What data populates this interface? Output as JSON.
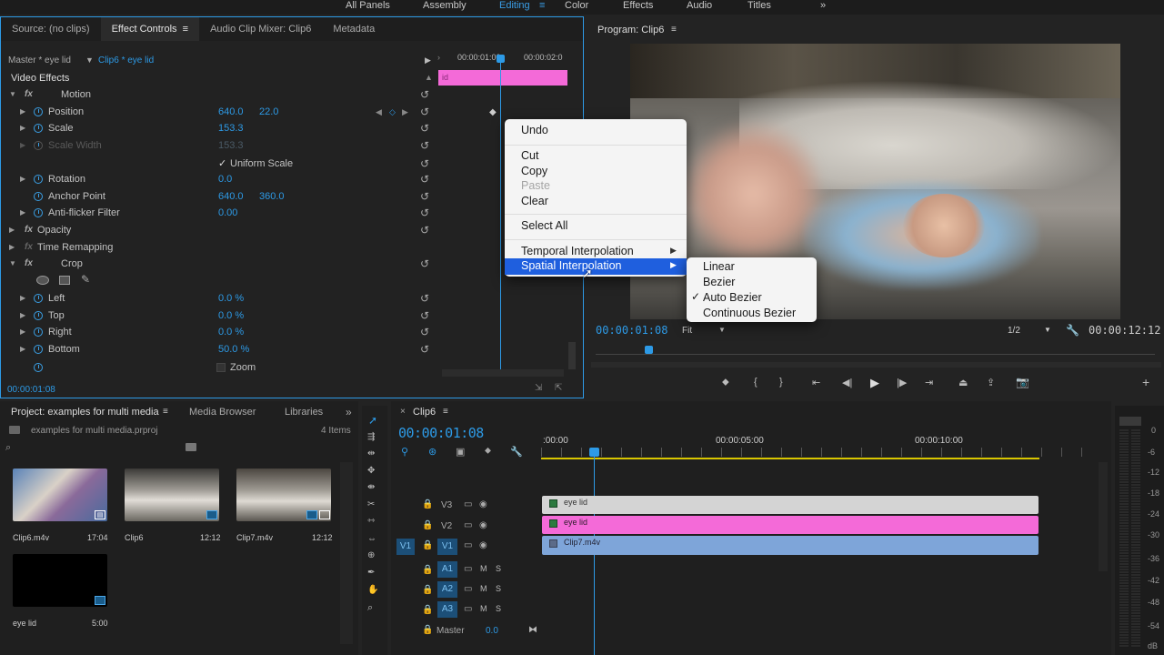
{
  "workspaces": [
    "All Panels",
    "Assembly",
    "Editing",
    "Color",
    "Effects",
    "Audio",
    "Titles"
  ],
  "workspace_active": "Editing",
  "source_panel": {
    "tabs": [
      "Source: (no clips)",
      "Effect Controls",
      "Audio Clip Mixer: Clip6",
      "Metadata"
    ],
    "master_label": "Master * eye lid",
    "clip_label": "Clip6 * eye lid",
    "section": "Video Effects",
    "timeline_times": [
      "00:00:01:00",
      "00:00:02:0"
    ],
    "clip_bar_label": "id",
    "rows": {
      "motion": "Motion",
      "position": {
        "label": "Position",
        "v1": "640.0",
        "v2": "22.0"
      },
      "scale": {
        "label": "Scale",
        "v1": "153.3"
      },
      "scale_width": {
        "label": "Scale Width",
        "v1": "153.3"
      },
      "uniform_scale": "Uniform Scale",
      "rotation": {
        "label": "Rotation",
        "v1": "0.0"
      },
      "anchor": {
        "label": "Anchor Point",
        "v1": "640.0",
        "v2": "360.0"
      },
      "antiflicker": {
        "label": "Anti-flicker Filter",
        "v1": "0.00"
      },
      "opacity": "Opacity",
      "time_remap": "Time Remapping",
      "crop": "Crop",
      "left": {
        "label": "Left",
        "v1": "0.0 %"
      },
      "top": {
        "label": "Top",
        "v1": "0.0 %"
      },
      "right": {
        "label": "Right",
        "v1": "0.0 %"
      },
      "bottom": {
        "label": "Bottom",
        "v1": "50.0 %"
      },
      "zoom": "Zoom"
    },
    "timecode": "00:00:01:08"
  },
  "context_menu": {
    "items": [
      "Undo",
      "Cut",
      "Copy",
      "Paste",
      "Clear",
      "Select All",
      "Temporal Interpolation",
      "Spatial Interpolation"
    ],
    "submenu": [
      "Linear",
      "Bezier",
      "Auto Bezier",
      "Continuous Bezier"
    ],
    "checked": "Auto Bezier"
  },
  "program": {
    "title": "Program: Clip6",
    "timecode": "00:00:01:08",
    "fit": "Fit",
    "resolution": "1/2",
    "duration": "00:00:12:12"
  },
  "project": {
    "tabs": [
      "Project: examples for multi media",
      "Media Browser",
      "Libraries"
    ],
    "file": "examples for multi media.prproj",
    "count": "4 Items",
    "items": [
      {
        "name": "Clip6.m4v",
        "dur": "17:04"
      },
      {
        "name": "Clip6",
        "dur": "12:12"
      },
      {
        "name": "Clip7.m4v",
        "dur": "12:12"
      },
      {
        "name": "eye lid",
        "dur": "5:00"
      }
    ]
  },
  "timeline": {
    "tab": "Clip6",
    "timecode": "00:00:01:08",
    "ruler": [
      ":00:00",
      "00:00:05:00",
      "00:00:10:00"
    ],
    "video_tracks": [
      "V3",
      "V2",
      "V1"
    ],
    "audio_tracks": [
      "A1",
      "A2",
      "A3"
    ],
    "master": "Master",
    "master_val": "0.0",
    "clips": {
      "v3": "eye lid",
      "v2": "eye lid",
      "v1": "Clip7.m4v"
    },
    "meter_labels": [
      "0",
      "-6",
      "-12",
      "-18",
      "-24",
      "-30",
      "-36",
      "-42",
      "-48",
      "-54",
      "dB"
    ]
  },
  "colors": {
    "accent": "#2d9ae6",
    "pink": "#f46ad8",
    "v1clip": "#7ea5d9",
    "v3clip": "#d4d4d4",
    "menu_highlight": "#1f5fde"
  }
}
